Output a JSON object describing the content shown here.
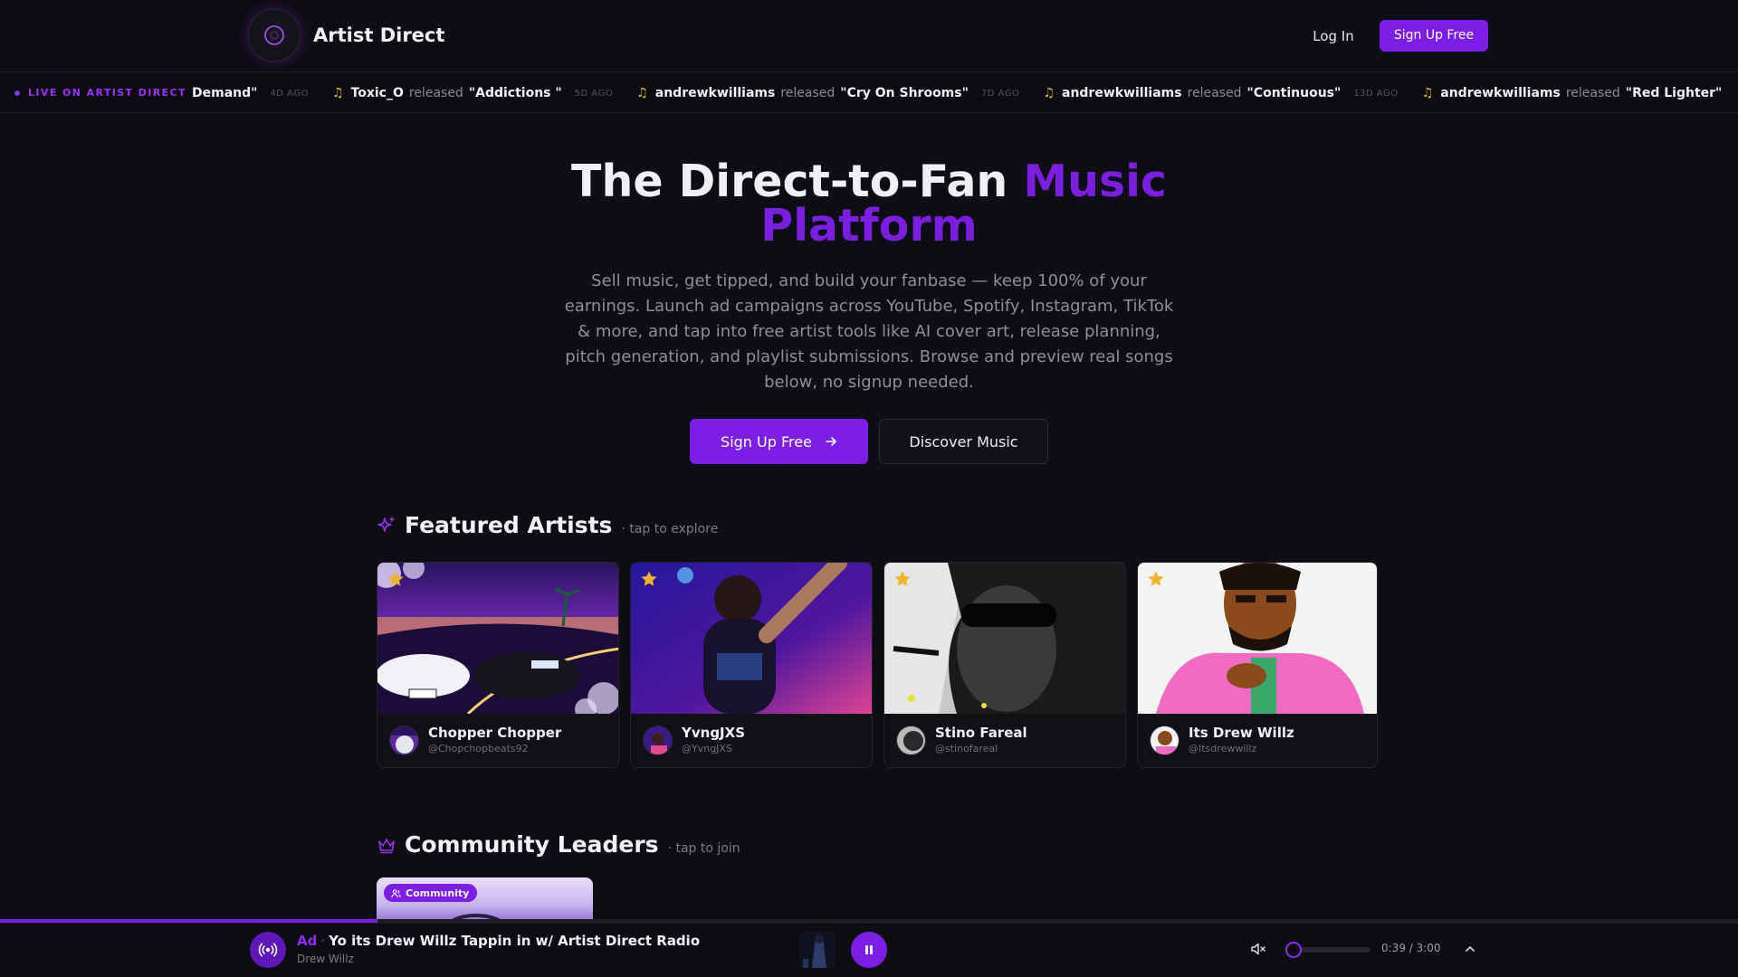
{
  "brand": {
    "name": "Artist Direct"
  },
  "nav": {
    "login_label": "Log In",
    "signup_label": "Sign Up Free"
  },
  "ticker": {
    "label": "LIVE ON ARTIST DIRECT",
    "items": [
      {
        "user": "",
        "verb": "",
        "song": "Demand\"",
        "ago": "4D AGO",
        "partial": true
      },
      {
        "user": "Toxic_O",
        "verb": "released",
        "song": "\"Addictions \"",
        "ago": "5D AGO"
      },
      {
        "user": "andrewkwilliams",
        "verb": "released",
        "song": "\"Cry On Shrooms\"",
        "ago": "7D AGO"
      },
      {
        "user": "andrewkwilliams",
        "verb": "released",
        "song": "\"Continuous\"",
        "ago": "13D AGO"
      },
      {
        "user": "andrewkwilliams",
        "verb": "released",
        "song": "\"Red Lighter\"",
        "ago": ""
      }
    ]
  },
  "hero": {
    "title_main": "The Direct-to-Fan ",
    "title_accent_1": "Music",
    "title_accent_2": "Platform",
    "subtitle": "Sell music, get tipped, and build your fanbase — keep 100% of your earnings. Launch ad campaigns across YouTube, Spotify, Instagram, TikTok & more, and tap into free artist tools like AI cover art, release planning, pitch generation, and playlist submissions. Browse and preview real songs below, no signup needed.",
    "primary_button": "Sign Up Free",
    "secondary_button": "Discover Music"
  },
  "featured": {
    "title": "Featured Artists",
    "hint": "· tap to explore",
    "artists": [
      {
        "name": "Chopper Chopper",
        "handle": "@Chopchopbeats92"
      },
      {
        "name": "YvngJXS",
        "handle": "@YvngJXS"
      },
      {
        "name": "Stino Fareal",
        "handle": "@stinofareal"
      },
      {
        "name": "Its Drew Willz",
        "handle": "@Itsdrewwillz"
      }
    ]
  },
  "community": {
    "title": "Community Leaders",
    "hint": "· tap to join",
    "badge": "Community"
  },
  "player": {
    "ad_label": "Ad",
    "separator": "·",
    "track_title": "Yo its Drew Willz Tappin in w/ Artist Direct Radio",
    "artist": "Drew Willz",
    "time": "0:39 / 3:00",
    "progress": 0.217,
    "volume": 0.0,
    "accent_color": "#7c1ee8"
  },
  "colors": {
    "background": "#0d0d13",
    "accent": "#7c1ee8",
    "accent_text": "#7a1ee0",
    "star": "#f0b429",
    "ticker_note": "#e8b930"
  }
}
